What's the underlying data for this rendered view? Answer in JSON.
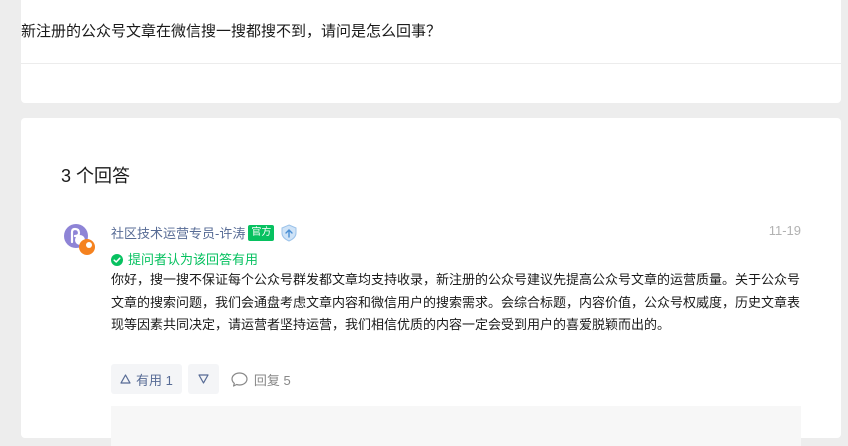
{
  "question": {
    "title": "新注册的公众号文章在微信搜一搜都搜不到，请问是怎么回事？"
  },
  "answers": {
    "heading": "3 个回答",
    "items": [
      {
        "author": "社区技术运营专员-许涛",
        "badge": "官方",
        "badge_color": "#07c160",
        "shield_icon": "shield-icon",
        "date": "11-19",
        "accepted_text": "提问者认为该回答有用",
        "accepted_color": "#07c160",
        "body": "你好，搜一搜不保证每个公众号群发都文章均支持收录，新注册的公众号建议先提高公众号文章的运营质量。关于公众号文章的搜索问题，我们会通盘考虑文章内容和微信用户的搜索需求。会综合标题，内容价值，公众号权威度，历史文章表现等因素共同决定，请运营者坚持运营，我们相信优质的内容一定会受到用户的喜爱脱颖而出的。",
        "useful_label": "有用 1",
        "reply_label": "回复 5"
      }
    ]
  },
  "colors": {
    "link": "#576b95",
    "muted": "#b2b2b2",
    "page_bg": "#ededed"
  }
}
